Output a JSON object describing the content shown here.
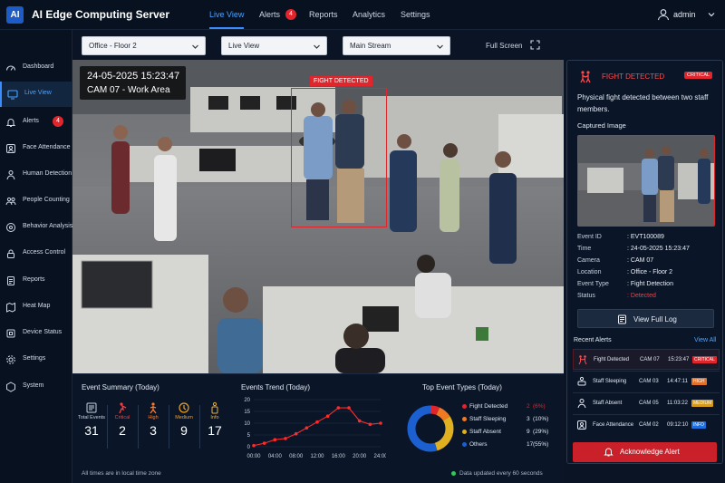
{
  "app": {
    "logo": "AI",
    "title": "AI Edge Computing Server"
  },
  "topnav": {
    "items": [
      {
        "label": "Live View",
        "active": true
      },
      {
        "label": "Alerts",
        "badge": "4"
      },
      {
        "label": "Reports"
      },
      {
        "label": "Analytics"
      },
      {
        "label": "Settings"
      }
    ],
    "user": {
      "icon": "user-icon",
      "name": "admin"
    }
  },
  "sidebar": {
    "items": [
      {
        "label": "Dashboard",
        "icon": "dashboard-icon"
      },
      {
        "label": "Live View",
        "icon": "camera-icon",
        "active": true
      },
      {
        "label": "Alerts",
        "icon": "bell-icon",
        "badge": "4"
      },
      {
        "label": "Face Attendance",
        "icon": "face-icon"
      },
      {
        "label": "Human Detection",
        "icon": "person-icon"
      },
      {
        "label": "People Counting",
        "icon": "people-icon"
      },
      {
        "label": "Behavior Analysis",
        "icon": "behavior-icon"
      },
      {
        "label": "Access Control",
        "icon": "lock-icon"
      },
      {
        "label": "Reports",
        "icon": "report-icon"
      },
      {
        "label": "Heat Map",
        "icon": "map-icon"
      },
      {
        "label": "Device Status",
        "icon": "device-icon"
      },
      {
        "label": "Settings",
        "icon": "gear-icon"
      },
      {
        "label": "System",
        "icon": "system-icon"
      }
    ]
  },
  "toolbar": {
    "location": "Office - Floor 2",
    "view": "Live View",
    "stream": "Main Stream",
    "fullscreen": "Full Screen"
  },
  "video": {
    "datetime": "24-05-2025  15:23:47",
    "camera": "CAM 07 - Work Area",
    "detection_label": "FIGHT DETECTED"
  },
  "summary": {
    "title": "Event Summary (Today)",
    "items": [
      {
        "label": "Total Events",
        "value": "31",
        "color": "#c7d0de",
        "icon": "events-icon"
      },
      {
        "label": "Critical",
        "value": "2",
        "color": "#ff3b3b",
        "icon": "critical-icon"
      },
      {
        "label": "High",
        "value": "3",
        "color": "#ff7a2a",
        "icon": "high-icon"
      },
      {
        "label": "Medium",
        "value": "9",
        "color": "#f0a020",
        "icon": "medium-icon"
      },
      {
        "label": "Info",
        "value": "17",
        "color": "#f0b030",
        "icon": "info-icon"
      }
    ]
  },
  "trend": {
    "title": "Events Trend (Today)"
  },
  "chart_data": [
    {
      "type": "line",
      "title": "Events Trend (Today)",
      "x": [
        "00:00",
        "02:00",
        "04:00",
        "06:00",
        "08:00",
        "10:00",
        "12:00",
        "14:00",
        "16:00",
        "18:00",
        "20:00",
        "22:00",
        "24:00"
      ],
      "xticks": [
        "00:00",
        "04:00",
        "08:00",
        "12:00",
        "16:00",
        "20:00",
        "24:00"
      ],
      "series": [
        {
          "values": [
            0.5,
            1.5,
            3,
            3.5,
            5.5,
            8,
            10.5,
            13,
            16.5,
            16.5,
            11,
            9.5,
            10
          ]
        }
      ],
      "ylim": [
        0,
        20
      ],
      "yticks": [
        "0",
        "5",
        "10",
        "15",
        "20"
      ],
      "color": "#ff2a2a"
    },
    {
      "type": "pie",
      "title": "Top Event Types (Today)",
      "labels": [
        "Fight Detected",
        "Staff Sleeping",
        "Staff Absent",
        "Others"
      ],
      "values": [
        2,
        3,
        9,
        17
      ],
      "percents": [
        "(6%)",
        "(10%)",
        "(29%)",
        "(55%)"
      ],
      "colors": [
        "#e0262c",
        "#f07a22",
        "#e0b020",
        "#1c5fd0"
      ]
    }
  ],
  "alert": {
    "title": "FIGHT DETECTED",
    "severity": "CRITICAL",
    "description": "Physical fight detected between two staff members.",
    "captured_label": "Captured Image",
    "details": [
      {
        "key": "Event ID",
        "value": ": EVT100089"
      },
      {
        "key": "Time",
        "value": ": 24-05-2025 15:23:47"
      },
      {
        "key": "Camera",
        "value": ": CAM 07"
      },
      {
        "key": "Location",
        "value": ": Office - Floor 2"
      },
      {
        "key": "Event Type",
        "value": ": Fight Detection"
      },
      {
        "key": "Status",
        "value": ": Detected",
        "color": "#ff3b3b"
      }
    ],
    "full_log": "View Full Log",
    "recent_title": "Recent Alerts",
    "view_all": "View All",
    "recent": [
      {
        "name": "Fight Detected",
        "cam": "CAM 07",
        "time": "15:23:47",
        "severity": "CRITICAL",
        "color": "#e0262c",
        "icon": "fight-icon"
      },
      {
        "name": "Staff Sleeping",
        "cam": "CAM 03",
        "time": "14:47:11",
        "severity": "HIGH",
        "color": "#e0702a",
        "icon": "sleeping-icon"
      },
      {
        "name": "Staff Absent",
        "cam": "CAM 05",
        "time": "11:03:22",
        "severity": "MEDIUM",
        "color": "#d49a1a",
        "icon": "absent-icon"
      },
      {
        "name": "Face Attendance",
        "cam": "CAM 02",
        "time": "09:12:10",
        "severity": "INFO",
        "color": "#1c6fe0",
        "icon": "face-icon"
      }
    ],
    "acknowledge": "Acknowledge Alert"
  },
  "footer": {
    "timezone_note": "All times are in local time zone",
    "update_note": "Data updated every 60 seconds"
  }
}
